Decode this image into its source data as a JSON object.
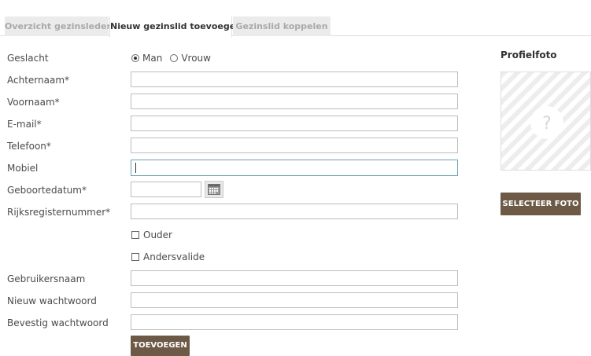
{
  "tabs": [
    {
      "label": "Overzicht gezinsleden"
    },
    {
      "label": "Nieuw gezinslid toevoegen"
    },
    {
      "label": "Gezinslid koppelen"
    }
  ],
  "form": {
    "gender_label": "Geslacht",
    "gender_options": [
      "Man",
      "Vrouw"
    ],
    "gender_selected": "Man",
    "lastname_label": "Achternaam*",
    "firstname_label": "Voornaam*",
    "email_label": "E-mail*",
    "phone_label": "Telefoon*",
    "mobile_label": "Mobiel",
    "birthdate_label": "Geboortedatum*",
    "registry_label": "Rijksregisternummer*",
    "parent_label": "Ouder",
    "disabled_label": "Andersvalide",
    "username_label": "Gebruikersnaam",
    "new_password_label": "Nieuw wachtwoord",
    "confirm_password_label": "Bevestig wachtwoord",
    "submit_label": "TOEVOEGEN"
  },
  "profile": {
    "title": "Profielfoto",
    "placeholder_symbol": "?",
    "select_label": "SELECTEER FOTO"
  },
  "icons": {
    "calendar": "calendar-icon",
    "photo_placeholder": "question-circle-icon"
  },
  "colors": {
    "button_bg": "#6d5a46",
    "focus_border": "#6aa3b3",
    "tab_inactive_bg": "#ebebeb"
  }
}
